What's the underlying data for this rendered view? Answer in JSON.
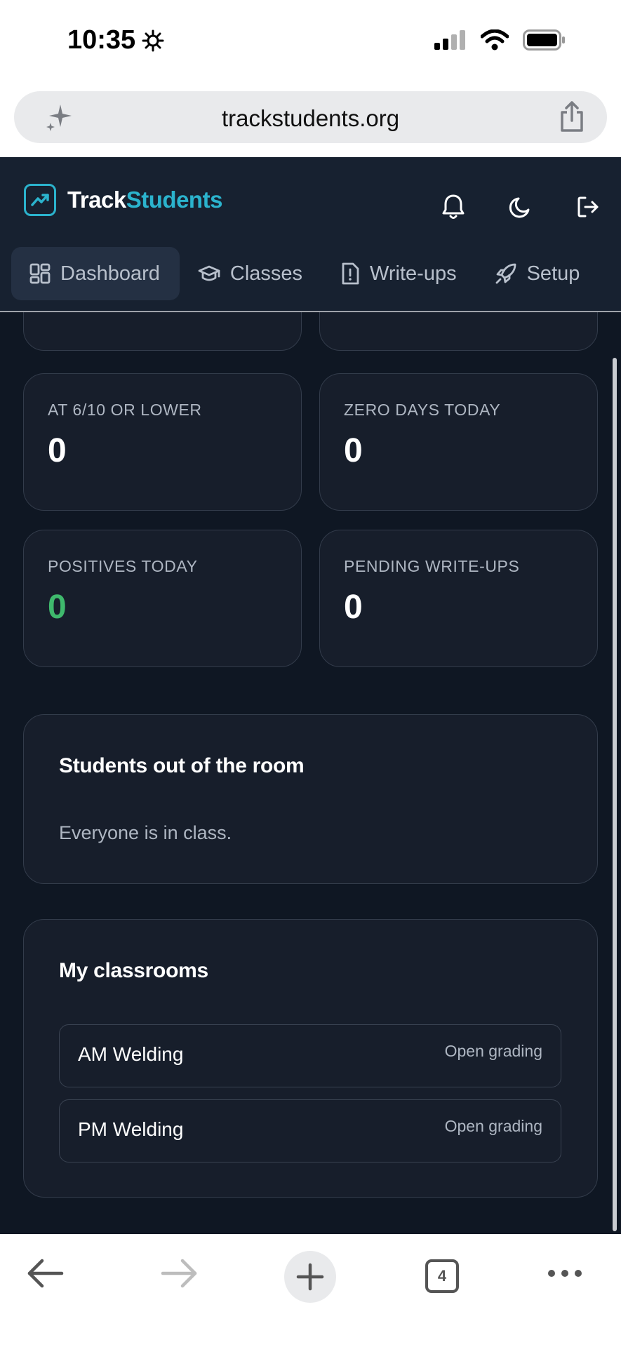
{
  "status_bar": {
    "time": "10:35"
  },
  "browser": {
    "url": "trackstudents.org",
    "open_tabs": "4"
  },
  "header": {
    "brand_part1": "Track",
    "brand_part2": "Students",
    "accent_color": "#2bb3cd"
  },
  "nav": {
    "tabs": [
      {
        "label": "Dashboard",
        "icon": "dashboard-grid-icon",
        "active": true
      },
      {
        "label": "Classes",
        "icon": "graduation-cap-icon",
        "active": false
      },
      {
        "label": "Write-ups",
        "icon": "file-alert-icon",
        "active": false
      },
      {
        "label": "Setup",
        "icon": "rocket-icon",
        "active": false
      }
    ]
  },
  "stats": [
    {
      "label": "AT 6/10 OR LOWER",
      "value": "0"
    },
    {
      "label": "ZERO DAYS TODAY",
      "value": "0"
    },
    {
      "label": "POSITIVES TODAY",
      "value": "0",
      "color": "#3fb96d"
    },
    {
      "label": "PENDING WRITE-UPS",
      "value": "0"
    }
  ],
  "out_of_room": {
    "title": "Students out of the room",
    "empty_message": "Everyone is in class."
  },
  "classrooms": {
    "title": "My classrooms",
    "items": [
      {
        "name": "AM Welding",
        "action": "Open grading"
      },
      {
        "name": "PM Welding",
        "action": "Open grading"
      }
    ]
  }
}
